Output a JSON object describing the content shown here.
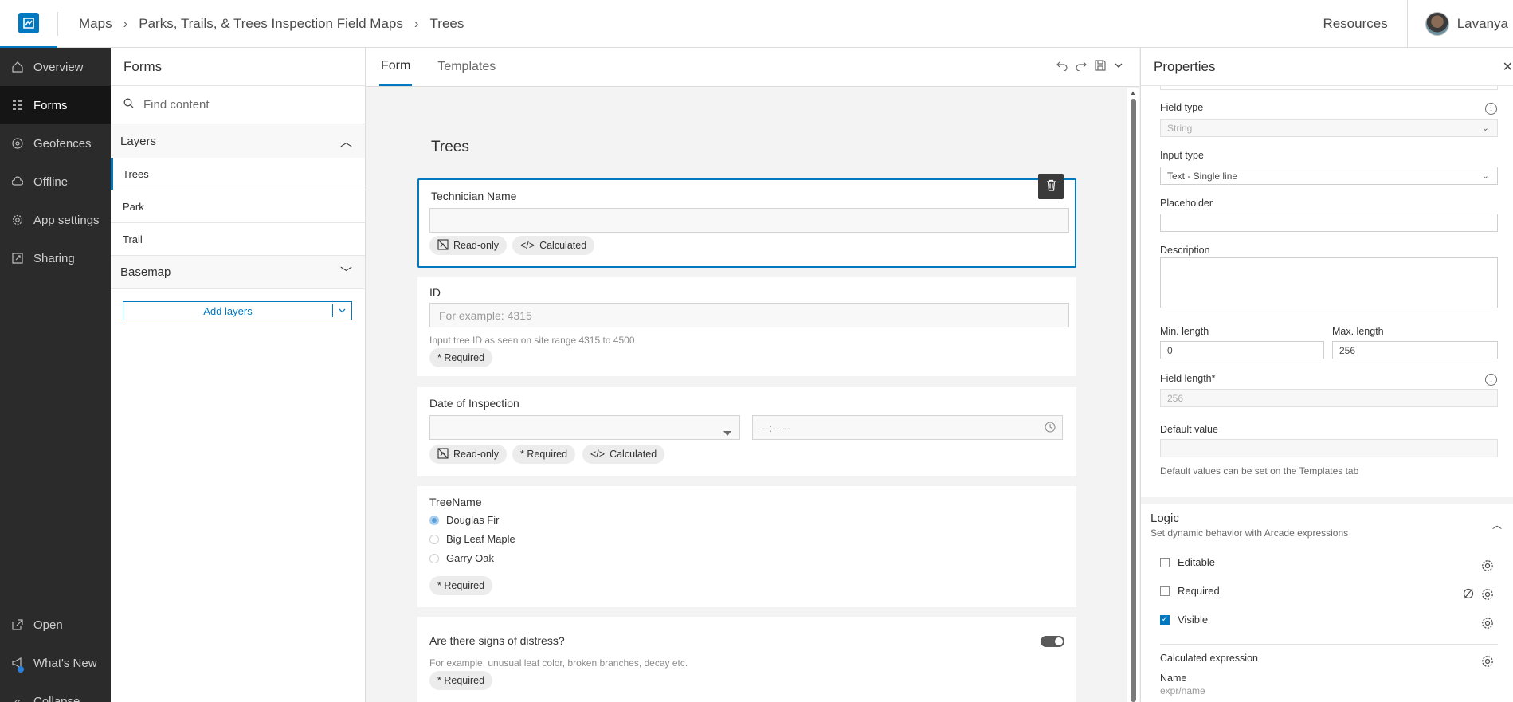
{
  "topbar": {
    "breadcrumbs": [
      "Maps",
      "Parks, Trails, & Trees Inspection Field Maps",
      "Trees"
    ],
    "resources": "Resources",
    "user_name": "Lavanya"
  },
  "leftnav": {
    "items": [
      {
        "label": "Overview",
        "icon": "home-icon"
      },
      {
        "label": "Forms",
        "icon": "forms-icon"
      },
      {
        "label": "Geofences",
        "icon": "geofence-icon"
      },
      {
        "label": "Offline",
        "icon": "cloud-icon"
      },
      {
        "label": "App settings",
        "icon": "gear-icon"
      },
      {
        "label": "Sharing",
        "icon": "share-icon"
      }
    ],
    "bottom": [
      {
        "label": "Open",
        "icon": "open-icon"
      },
      {
        "label": "What's New",
        "icon": "megaphone-icon"
      },
      {
        "label": "Collapse",
        "icon": "collapse-icon"
      }
    ]
  },
  "forms_panel": {
    "title": "Forms",
    "search_placeholder": "Find content",
    "layers_label": "Layers",
    "layers": [
      "Trees",
      "Park",
      "Trail"
    ],
    "basemap_label": "Basemap",
    "add_layers": "Add layers"
  },
  "center": {
    "tabs": [
      "Form",
      "Templates"
    ],
    "form_title": "Trees",
    "fields": {
      "technician": {
        "label": "Technician Name",
        "chips": [
          "Read-only",
          "Calculated"
        ]
      },
      "id": {
        "label": "ID",
        "placeholder": "For example: 4315",
        "hint": "Input tree ID as seen on site range 4315 to 4500",
        "chips": [
          "* Required"
        ]
      },
      "date": {
        "label": "Date of Inspection",
        "time_placeholder": "--:-- --",
        "chips": [
          "Read-only",
          "* Required",
          "Calculated"
        ]
      },
      "treename": {
        "label": "TreeName",
        "options": [
          "Douglas Fir",
          "Big Leaf Maple",
          "Garry Oak"
        ],
        "chips": [
          "* Required"
        ]
      },
      "distress": {
        "label": "Are there signs of distress?",
        "hint": "For example: unusual leaf color, broken branches, decay etc.",
        "chips": [
          "* Required"
        ]
      }
    }
  },
  "properties": {
    "title": "Properties",
    "field_type_label": "Field type",
    "field_type_value": "String",
    "input_type_label": "Input type",
    "input_type_value": "Text - Single line",
    "placeholder_label": "Placeholder",
    "description_label": "Description",
    "min_length_label": "Min. length",
    "min_length_value": "0",
    "max_length_label": "Max. length",
    "max_length_value": "256",
    "field_length_label": "Field length*",
    "field_length_value": "256",
    "default_value_label": "Default value",
    "default_value_hint": "Default values can be set on the Templates tab",
    "logic_title": "Logic",
    "logic_subtitle": "Set dynamic behavior with Arcade expressions",
    "logic_items": [
      {
        "label": "Editable",
        "checked": false
      },
      {
        "label": "Required",
        "checked": false
      },
      {
        "label": "Visible",
        "checked": true
      }
    ],
    "calc_label": "Calculated expression",
    "name_label": "Name",
    "name_value": "expr/name"
  }
}
